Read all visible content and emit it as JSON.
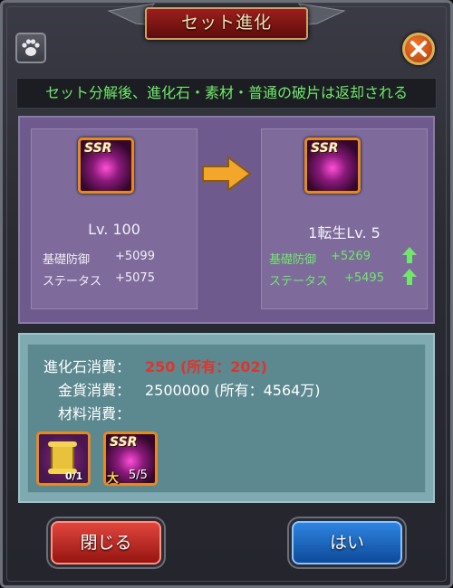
{
  "dialog": {
    "title": "セット進化",
    "notice": "セット分解後、進化石・素材・普通の破片は返却される"
  },
  "current": {
    "rarity": "SSR",
    "level": "Lv. 100",
    "stats": [
      {
        "label": "基礎防御",
        "value": "+5099"
      },
      {
        "label": "ステータス",
        "value": "+5075"
      }
    ]
  },
  "evolved": {
    "rarity": "SSR",
    "level": "1転生Lv. 5",
    "stats": [
      {
        "label": "基礎防御",
        "value": "+5269"
      },
      {
        "label": "ステータス",
        "value": "+5495"
      }
    ]
  },
  "cost": {
    "stone_label": "進化石消費：",
    "stone_value": "250 (所有：202)",
    "gold_label": "金貨消費：",
    "gold_value": "2500000 (所有：4564万)",
    "material_label": "材料消費：",
    "materials": [
      {
        "name": "scroll-item",
        "count": "0/1"
      },
      {
        "name": "ssr-fragment",
        "rarity": "SSR",
        "badge": "大",
        "count": "5/5"
      }
    ]
  },
  "buttons": {
    "close": "閉じる",
    "yes": "はい"
  },
  "colors": {
    "highlight_green": "#6fe86a",
    "warn_red": "#e2332a",
    "panel_purple": "#6f5a8e",
    "cost_teal": "#5c8890"
  },
  "icons": [
    "paw-icon",
    "close-icon",
    "arrow-right-icon",
    "up-arrow-icon"
  ]
}
